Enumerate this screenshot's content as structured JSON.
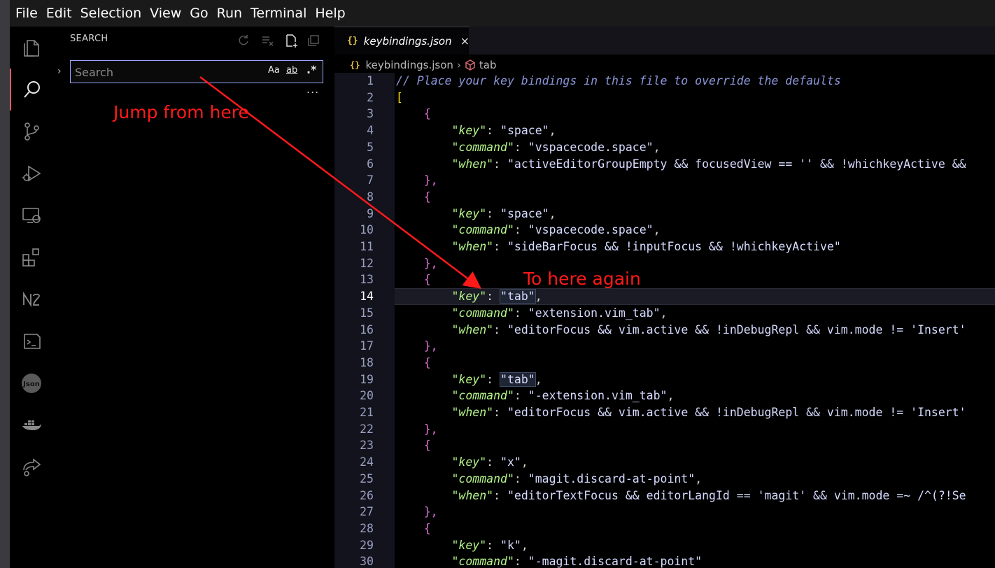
{
  "menubar": {
    "items": [
      "File",
      "Edit",
      "Selection",
      "View",
      "Go",
      "Run",
      "Terminal",
      "Help"
    ]
  },
  "activitybar": {
    "icons": [
      "explorer-icon",
      "search-icon",
      "source-control-icon",
      "run-debug-icon",
      "remote-explorer-icon",
      "extensions-icon",
      "n2-icon",
      "terminal-icon",
      "json-icon",
      "docker-icon",
      "live-share-icon"
    ]
  },
  "sidebar": {
    "title": "SEARCH",
    "search_placeholder": "Search",
    "search_value": "",
    "match_case": "Aa",
    "whole_word": "ab",
    "regex": ".*",
    "replace_toggle": "›",
    "more": "..."
  },
  "editor": {
    "tab_icon": "{}",
    "tab_label": "keybindings.json",
    "tab_close": "×",
    "breadcrumb_icon": "{}",
    "breadcrumb_file": "keybindings.json",
    "breadcrumb_sep": "›",
    "breadcrumb_symbol": "tab",
    "current_line": 14,
    "lines": [
      {
        "n": "1"
      },
      {
        "n": "2"
      },
      {
        "n": "3"
      },
      {
        "n": "4"
      },
      {
        "n": "5"
      },
      {
        "n": "6"
      },
      {
        "n": "7"
      },
      {
        "n": "8"
      },
      {
        "n": "9"
      },
      {
        "n": "10"
      },
      {
        "n": "11"
      },
      {
        "n": "12"
      },
      {
        "n": "13"
      },
      {
        "n": "14"
      },
      {
        "n": "15"
      },
      {
        "n": "16"
      },
      {
        "n": "17"
      },
      {
        "n": "18"
      },
      {
        "n": "19"
      },
      {
        "n": "20"
      },
      {
        "n": "21"
      },
      {
        "n": "22"
      },
      {
        "n": "23"
      },
      {
        "n": "24"
      },
      {
        "n": "25"
      },
      {
        "n": "26"
      },
      {
        "n": "27"
      },
      {
        "n": "28"
      },
      {
        "n": "29"
      },
      {
        "n": "30"
      }
    ],
    "code": {
      "l1": "// Place your key bindings in this file to override the defaults",
      "l2": "[",
      "brace_open": "{",
      "brace_close": "},",
      "k_key": "\"key\"",
      "k_command": "\"command\"",
      "k_when": "\"when\"",
      "v4": "\"space\"",
      "v5": "\"vspacecode.space\"",
      "v6": "\"activeEditorGroupEmpty && focusedView == '' && !whichkeyActive &&",
      "v9": "\"space\"",
      "v10": "\"vspacecode.space\"",
      "v11": "\"sideBarFocus && !inputFocus && !whichkeyActive\"",
      "v14": "\"tab\"",
      "v15": "\"extension.vim_tab\"",
      "v16": "\"editorFocus && vim.active && !inDebugRepl && vim.mode != 'Insert'",
      "v19": "\"tab\"",
      "v20": "\"-extension.vim_tab\"",
      "v21": "\"editorFocus && vim.active && !inDebugRepl && vim.mode != 'Insert'",
      "v24": "\"x\"",
      "v25": "\"magit.discard-at-point\"",
      "v26": "\"editorTextFocus && editorLangId == 'magit' && vim.mode =~ /^(?!Se",
      "v29": "\"k\"",
      "v30": "\"-magit.discard-at-point\""
    }
  },
  "annotations": {
    "from_label": "Jump from here",
    "to_label": "To here again",
    "arrow_color": "#ff1a1a"
  }
}
